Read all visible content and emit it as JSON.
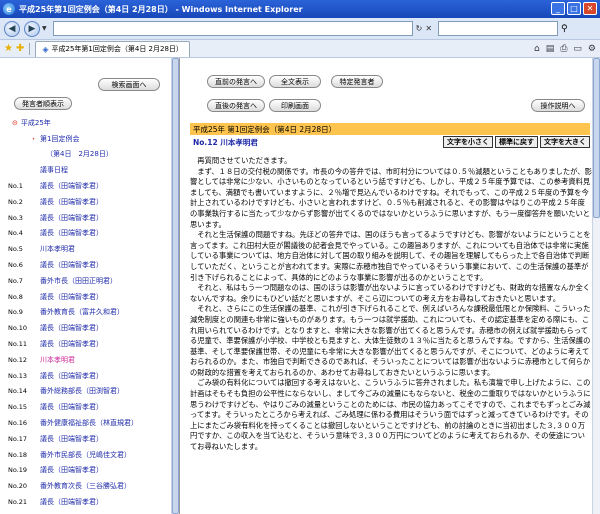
{
  "window": {
    "title": "平成25年第1回定例会（第4日 2月28日） - Windows Internet Explorer",
    "ie_glyph": "e",
    "minimize": "_",
    "maximize": "□",
    "close": "✕"
  },
  "addressbar": {
    "back": "◀",
    "forward": "▶",
    "dropdown": "▼",
    "refresh": "↻",
    "stop": "✕",
    "url": "",
    "search": "",
    "search_icon": "⚲"
  },
  "tabbar": {
    "favorites_icon": "★",
    "add_favorites_icon": "✚",
    "tab_icon": "◈",
    "tab_label": "平成25年第1回定例会（第4日 2月28日）",
    "home_icon": "⌂",
    "feeds_icon": "▤",
    "print_icon": "⎙",
    "page_icon": "▭",
    "tools_icon": "⚙"
  },
  "left": {
    "search_screen": "検索画面へ",
    "show_speakers": "発言者順表示",
    "tree_root": "平成25年",
    "session": "第1回定例会",
    "day": "（第4日　2月28日）",
    "agenda": "議事日程",
    "tree_expand_icon": "⊝",
    "tree_leaf_icon": "・",
    "entries": [
      {
        "num": "No.1",
        "name": "議長（田端智孝君）",
        "mayor": false
      },
      {
        "num": "No.2",
        "name": "議長（田端智孝君）",
        "mayor": false
      },
      {
        "num": "No.3",
        "name": "議長（田端智孝君）",
        "mayor": false
      },
      {
        "num": "No.4",
        "name": "議長（田端智孝君）",
        "mayor": false
      },
      {
        "num": "No.5",
        "name": "川本孝明君",
        "mayor": false
      },
      {
        "num": "No.6",
        "name": "議長（田端智孝君）",
        "mayor": false
      },
      {
        "num": "No.7",
        "name": "番外市長（田田正明君）",
        "mayor": false
      },
      {
        "num": "No.8",
        "name": "議長（田端智孝君）",
        "mayor": false
      },
      {
        "num": "No.9",
        "name": "番外教育長（富井久和君）",
        "mayor": false
      },
      {
        "num": "No.10",
        "name": "議長（田端智孝君）",
        "mayor": false
      },
      {
        "num": "No.11",
        "name": "議長（田端智孝君）",
        "mayor": false
      },
      {
        "num": "No.12",
        "name": "川本孝明君",
        "mayor": true
      },
      {
        "num": "No.13",
        "name": "議長（田端智孝君）",
        "mayor": false
      },
      {
        "num": "No.14",
        "name": "番外総務部長（田渕智君）",
        "mayor": false
      },
      {
        "num": "No.15",
        "name": "議長（田端智孝君）",
        "mayor": false
      },
      {
        "num": "No.16",
        "name": "番外健康福祉部長（林直規君）",
        "mayor": false
      },
      {
        "num": "No.17",
        "name": "議長（田端智孝君）",
        "mayor": false
      },
      {
        "num": "No.18",
        "name": "番外市民部長（児嶋佳文君）",
        "mayor": false
      },
      {
        "num": "No.19",
        "name": "議長（田端智孝君）",
        "mayor": false
      },
      {
        "num": "No.20",
        "name": "番外教育次長（三谷勝弘君）",
        "mayor": false
      },
      {
        "num": "No.21",
        "name": "議長（田端智孝君）",
        "mayor": false
      }
    ]
  },
  "right": {
    "prev_speaker": "直前の発言へ",
    "show_all": "全文表示",
    "specific_speaker": "特定発言者",
    "next_speaker": "直後の発言へ",
    "print_screen": "印刷画面",
    "operation_help": "操作説明へ",
    "header": "平成25年 第1回定例会（第4日 2月28日）",
    "speaker": "No.12 川本孝明君",
    "text_smaller": "文字を小さく",
    "text_standard": "標準に戻す",
    "text_larger": "文字を大きく",
    "speech": [
      "　再質問させていただきます。",
      "　まず、１８日の交付税の関係です。市長の今の答弁では、市町村分については０.５％減額ということもありましたが、影響としては非常に少ない、小さいものとなっているという話ですけども、しかし、平成２５年度予算では、この参考資料見ましても、満額でも書いていますように、２％増で見込んでいるわけですね。それでもって、この平成２５年度の予算を今計上されているわけですけども、小さいと言われますけど、０.５％も削減されると、その影響はやはりこの平成２５年度の事業執行するに当たって少なからず影響が出てくるのではないかというふうに思いますが、もう一度御答弁を願いたいと思います。",
      "　それと生活保護の問題ですね。先ほどの答弁では、国のほうも言ってるようですけども、影響がないようにということを言ってます。これ田村大臣が閣議後の記者会見でやっている。この趣旨ありますが、これについても自治体では非常に実施している事業については、地方自治体に対して国の取り組みを説明して、その趣旨を理解してもらった上で各自治体で判断していただく、ということが言われてます。実際に赤穂市独自でやっているそういう事業において、この生活保護の基準が引き下げられることによって、具体的にどのような事業に影響が出るのかということです。",
      "　それと、私はもう一つ問題なのは、国のほうは影響が出ないように言っているわけですけども、財政的な措置なんか全くないんですね。余りにもひどい話だと思いますが、そこら辺についての考え方をお尋ねしておきたいと思います。",
      "　それと、さらにこの生活保護の基準、これが引き下げられることで、例えばいろんな課税最低限とか保険料、こういった減免制度との関連も非常に強いものがあります。もう一つは就学援助、これについても、その認定基準を定める際にも、これ用いられているわけです。となりますと、非常に大きな影響が出てくると思うんです。赤穂市の例えば就学援助もらってる児童で、準要保護が小学校、中学校とも見ますと、大体生徒数の１３％に当たると思うんですね。ですから、生活保護の基準、そして準要保護世帯、その児童にも非常に大きな影響が出てくると思うんですが、そこについて、どのように考えておられるのか。また、市独自で判断できるのであれば、そういったことについては影響が出ないように赤穂市として何らかの財政的な措置を考えておられるのか、あわせてお尋ねしておきたいというふうに思います。",
      "　ごみ袋の有料化については撤回する考えはないと、こういうふうに答弁されました。私も演壇で申し上げたように、この計画はそもそも負担の公平性にならないし、まして今ごみの減量にもならないと、税金の二重取りではないかというふうに思うわけですけども、やはりごみの減量ということのためには、市民の協力あってこそですので、これまでもずっとごみ減ってます。そういったところから考えれば、ごみ処理に係わる費用はそういう面ではずっと減ってきているわけです。その上にまたごみ袋有料化を持ってくることは撤回しないということですけども、前の討論のときに当初出ました３,３００万円ですか、この収入を当て込むと、そういう意味で３,３００万円についてどのように考えておられるか、その使途についてお尋ねいたします。"
    ]
  }
}
